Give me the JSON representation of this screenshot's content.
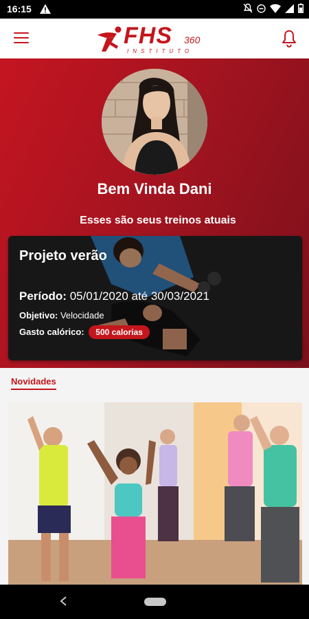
{
  "status": {
    "time": "16:15"
  },
  "header": {
    "logo_text": "FHS",
    "logo_suffix": "360",
    "logo_sub": "INSTITUTO"
  },
  "profile": {
    "welcome": "Bem Vinda Dani",
    "subtitle": "Esses são seus treinos atuais"
  },
  "program": {
    "title": "Projeto verão",
    "periodo_label": "Período:",
    "periodo_value": "05/01/2020 até 30/03/2021",
    "objetivo_label": "Objetivo:",
    "objetivo_value": "Velocidade",
    "gasto_label": "Gasto calórico:",
    "gasto_value": "500 calorias"
  },
  "news": {
    "label": "Novidades"
  },
  "colors": {
    "brand": "#c4161c",
    "hero_dark": "#7a101b"
  },
  "icons": [
    "menu-icon",
    "notification-bell-icon",
    "warning-icon",
    "wifi-icon",
    "battery-icon",
    "back-icon"
  ]
}
